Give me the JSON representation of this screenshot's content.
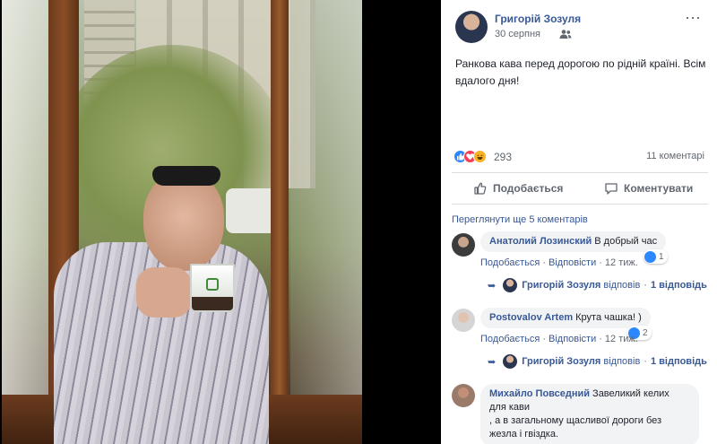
{
  "photo": {
    "description_icon": "photo-of-man-drinking-coffee"
  },
  "post": {
    "author": "Григорій Зозуля",
    "date": "30 серпня",
    "audience_icon": "friends-icon",
    "close_icon": "more-options-icon",
    "close_label": "⋯",
    "text": "Ранкова кава перед дорогою по рідній країні. Всім вдалого дня!",
    "reaction_count": "293",
    "comment_count": "11 коментарі",
    "like_label": "Подобається",
    "comment_label": "Коментувати"
  },
  "comments_section": {
    "more_comments": "Переглянути ще 5 коментарів",
    "comments": [
      {
        "name": "Анатолий Лозинский",
        "text": "В добрый час",
        "like_label": "Подобається",
        "reply_label": "Відповісти",
        "time": "12 тиж.",
        "reactions": "1",
        "reply_author": "Григорій Зозуля",
        "reply_word": "відповів",
        "reply_count": "1 відповідь"
      },
      {
        "name": "Postovalov Artem",
        "text": "Крута чашка! )",
        "like_label": "Подобається",
        "reply_label": "Відповісти",
        "time": "12 тиж.",
        "reactions": "2",
        "reply_author": "Григорій Зозуля",
        "reply_word": "відповів",
        "reply_count": "1 відповідь"
      },
      {
        "name": "Михайло Повседний",
        "text_line1": "Завеликий келих",
        "text_line2": "для кави",
        "text_line3": ", а в загальному щасливої дороги без",
        "text_line4": "жезла і гвіздка."
      }
    ]
  },
  "colors": {
    "link": "#385898",
    "author": "#365899",
    "muted": "#606770",
    "bubble": "#f2f3f5",
    "like_blue": "#2d88ff",
    "love_red": "#f33e58",
    "haha_yellow": "#f7b125"
  }
}
